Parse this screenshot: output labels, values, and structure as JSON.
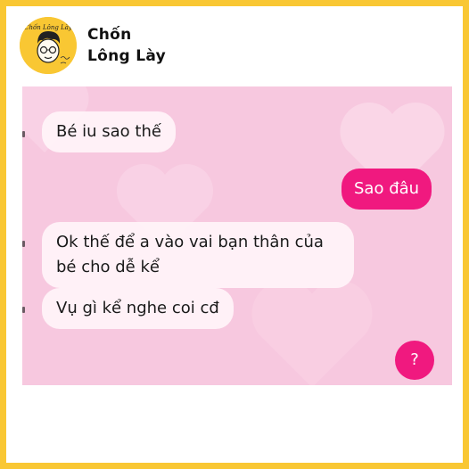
{
  "page": {
    "name": "Chốn Lông Lày",
    "name_line1": "Chốn",
    "name_line2": "Lông Lày",
    "logo_text": "Chốn Lông Lày"
  },
  "chat": {
    "messages": [
      {
        "direction": "incoming",
        "text": "Bé iu sao thế"
      },
      {
        "direction": "outgoing",
        "text": "Sao đâu"
      },
      {
        "direction": "incoming",
        "text": "Ok thế để a vào vai bạn thân của bé cho dễ kể"
      },
      {
        "direction": "incoming",
        "text": "Vụ gì kể nghe coi cđ"
      }
    ],
    "help_label": "?"
  },
  "colors": {
    "frame": "#f9c733",
    "chat_background": "#f7c8df",
    "incoming_bubble": "#fff4f8",
    "outgoing_bubble": "#f0197f"
  }
}
